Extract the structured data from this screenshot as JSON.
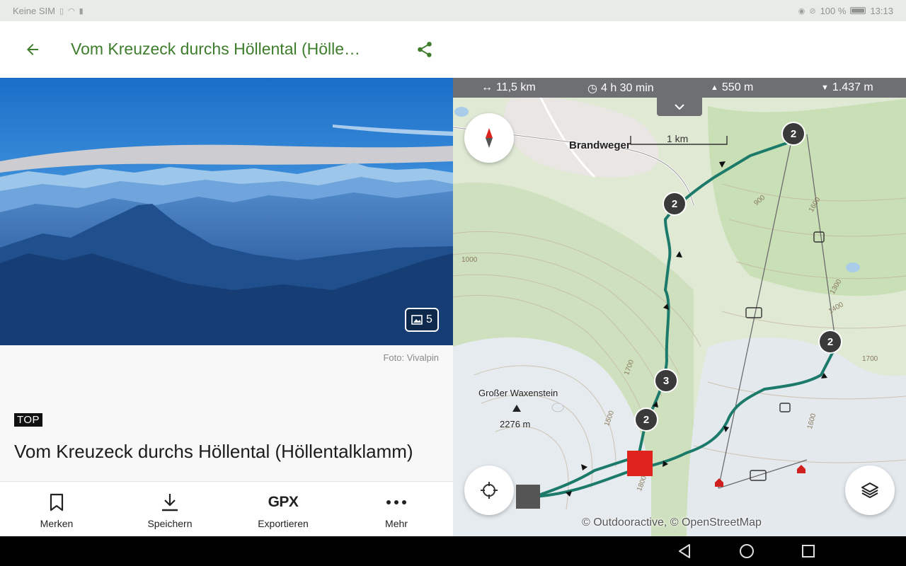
{
  "status_bar": {
    "carrier": "Keine SIM",
    "battery": "100 %",
    "time": "13:13"
  },
  "header": {
    "title": "Vom Kreuzeck durchs Höllental (Hölle…",
    "back_icon": "arrow-left-icon",
    "share_icon": "share-icon"
  },
  "gallery": {
    "photo_count": "5",
    "credit": "Foto: Vivalpin"
  },
  "tour": {
    "badge": "TOP",
    "title": "Vom Kreuzeck durchs Höllental (Höllentalklamm)"
  },
  "actions": [
    {
      "label": "Merken",
      "icon": "bookmark-icon"
    },
    {
      "label": "Speichern",
      "icon": "download-icon"
    },
    {
      "label": "Exportieren",
      "icon": "gpx-icon",
      "glyph": "GPX"
    },
    {
      "label": "Mehr",
      "icon": "more-icon"
    }
  ],
  "map": {
    "stats": {
      "distance": "11,5 km",
      "duration": "4 h 30 min",
      "ascent": "550 m",
      "descent": "1.437 m"
    },
    "scale_label": "1 km",
    "places": {
      "village": "Brandweger",
      "peak_name": "Großer Waxenstein",
      "peak_elevation": "2276 m"
    },
    "waypoint_labels": [
      "2",
      "2",
      "2",
      "3",
      "2"
    ],
    "contour_labels": [
      "900",
      "1000",
      "1300",
      "1400",
      "1500",
      "1600",
      "1700",
      "1800",
      "1600",
      "1700"
    ],
    "copyright": "© Outdooractive, © OpenStreetMap",
    "route_color": "#1b7a6a",
    "start_color": "#555555",
    "end_color": "#e1231d"
  },
  "theme": {
    "accent": "#3d7d2c"
  }
}
